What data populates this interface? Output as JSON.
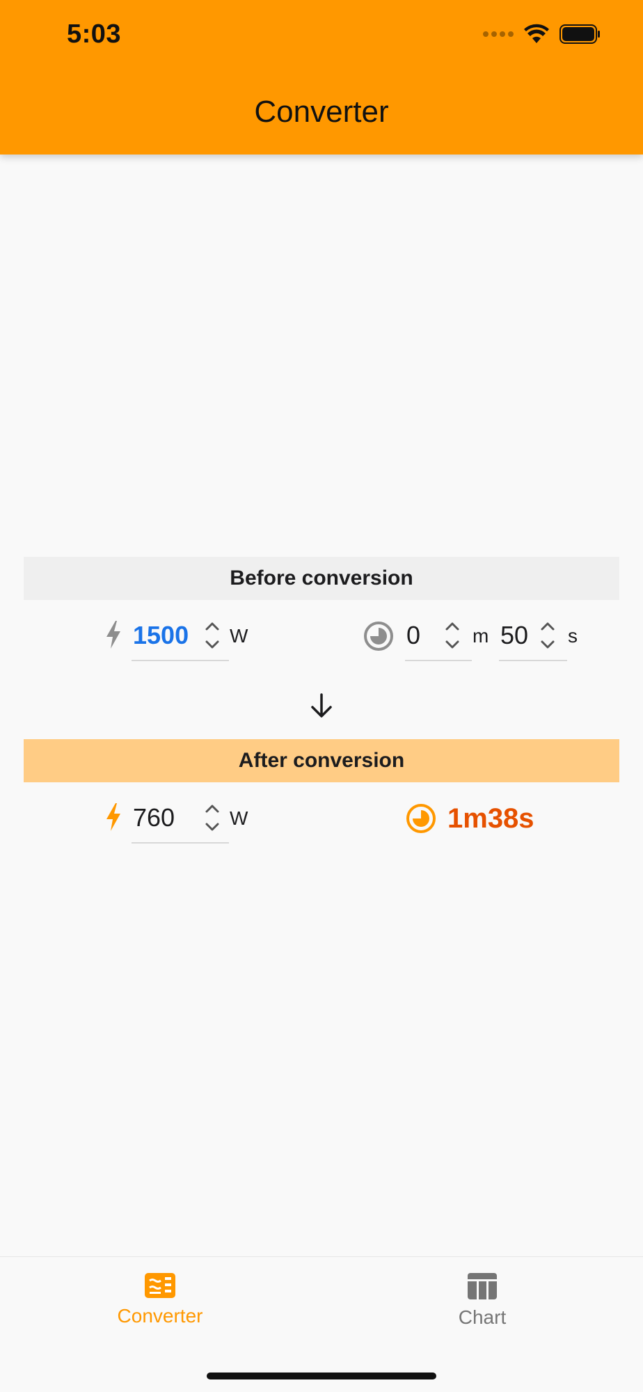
{
  "status_bar": {
    "time": "5:03"
  },
  "header": {
    "title": "Converter"
  },
  "before": {
    "label": "Before conversion",
    "power_value": "1500",
    "power_unit": "W",
    "minutes_value": "0",
    "minutes_unit": "m",
    "seconds_value": "50",
    "seconds_unit": "s"
  },
  "after": {
    "label": "After conversion",
    "power_value": "760",
    "power_unit": "W",
    "result_time": "1m38s"
  },
  "nav": {
    "items": [
      {
        "label": "Converter",
        "icon": "converter-icon",
        "active": true
      },
      {
        "label": "Chart",
        "icon": "chart-icon",
        "active": false
      }
    ]
  },
  "colors": {
    "accent": "#ff9800",
    "value_blue": "#1a73e8",
    "result": "#e65100",
    "after_band": "#ffcc85"
  }
}
